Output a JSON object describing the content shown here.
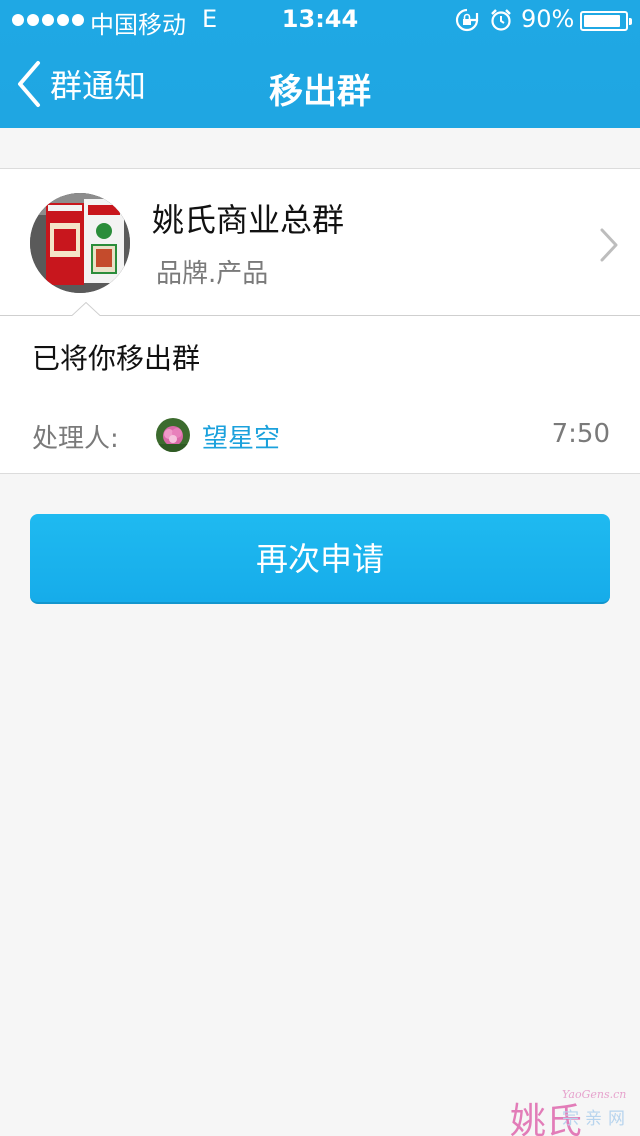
{
  "status_bar": {
    "carrier": "中国移动",
    "network": "E",
    "time": "13:44",
    "battery_percent": "90%",
    "battery_level": 0.9
  },
  "nav": {
    "back_label": "群通知",
    "title": "移出群"
  },
  "group": {
    "name": "姚氏商业总群",
    "tag": "品牌.产品"
  },
  "notice": {
    "message": "已将你移出群",
    "handler_label": "处理人:",
    "handler_name": "望星空",
    "time": "7:50"
  },
  "actions": {
    "reapply_label": "再次申请"
  },
  "watermark": {
    "main": "姚氏",
    "url": "YaoGens.cn",
    "sub": "宗亲网"
  },
  "colors": {
    "header_blue": "#1fa8e4",
    "button_blue": "#1bb4ee",
    "link_blue": "#1ba1dc",
    "background": "#f6f6f6"
  }
}
